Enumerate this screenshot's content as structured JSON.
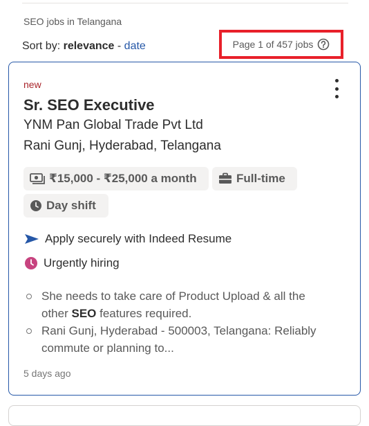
{
  "header": {
    "breadcrumb": "SEO jobs in Telangana",
    "sort_prefix": "Sort by:",
    "sort_active": "relevance",
    "sort_separator": "-",
    "sort_alt": "date",
    "page_count": "Page 1 of 457 jobs",
    "help_icon": "question-circle-icon"
  },
  "job": {
    "badge": "new",
    "title": "Sr. SEO Executive",
    "company": "YNM Pan Global Trade Pvt Ltd",
    "location": "Rani Gunj, Hyderabad, Telangana",
    "salary": "₹15,000 - ₹25,000 a month",
    "job_type": "Full-time",
    "shift": "Day shift",
    "apply": "Apply securely with Indeed Resume",
    "urgent": "Urgently hiring",
    "snippet_1a": "She needs to take care of Product Upload & all the other ",
    "snippet_1b": "SEO",
    "snippet_1c": " features required.",
    "snippet_2": "Rani Gunj, Hyderabad - 500003, Telangana: Reliably commute or planning to...",
    "posted": "5 days ago"
  },
  "colors": {
    "accent": "#2557a7",
    "new_badge": "#a9252b",
    "urgent": "#c7437f",
    "highlight_box": "#e8202a"
  }
}
